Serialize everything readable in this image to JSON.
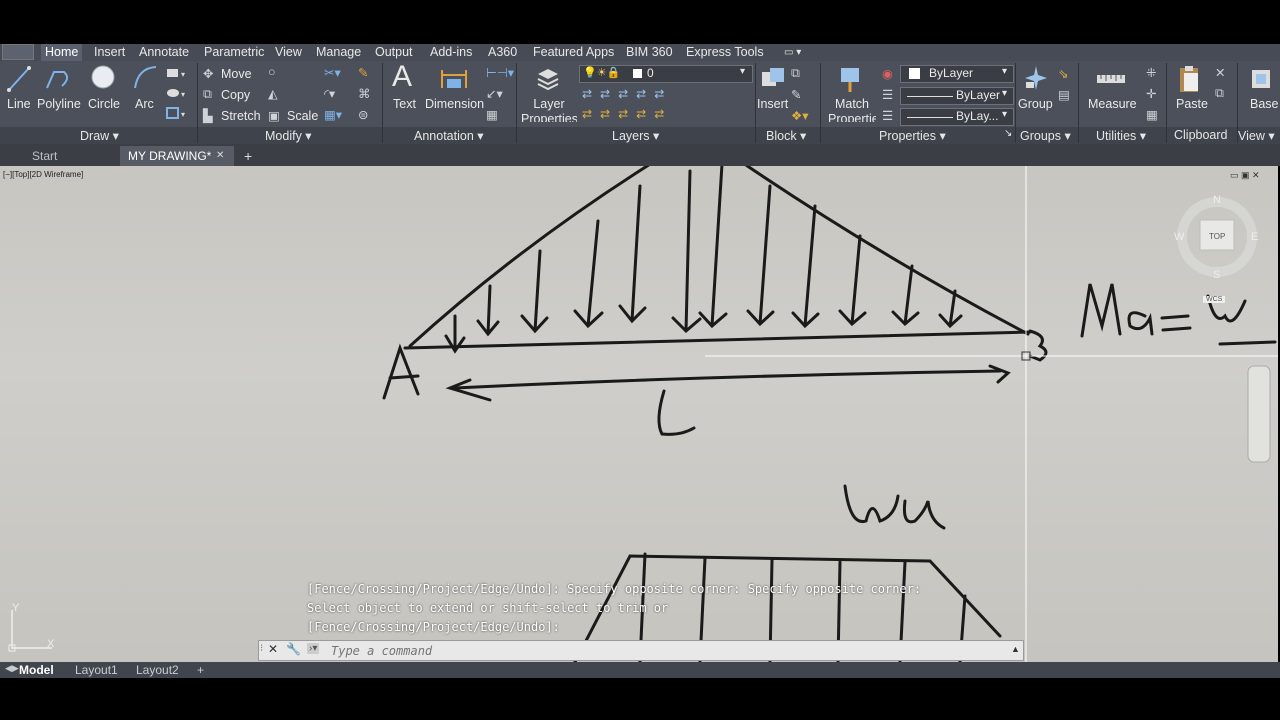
{
  "ribbon": {
    "tabs": [
      "Home",
      "Insert",
      "Annotate",
      "Parametric",
      "View",
      "Manage",
      "Output",
      "Add-ins",
      "A360",
      "Featured Apps",
      "BIM 360",
      "Express Tools"
    ],
    "draw": {
      "line": "Line",
      "polyline": "Polyline",
      "circle": "Circle",
      "arc": "Arc",
      "panel": "Draw"
    },
    "modify": {
      "move": "Move",
      "copy": "Copy",
      "stretch": "Stretch",
      "scale": "Scale",
      "panel": "Modify"
    },
    "annotation": {
      "text": "Text",
      "dimension": "Dimension",
      "panel": "Annotation"
    },
    "layers": {
      "layer_properties": "Layer Properties",
      "current_layer": "0",
      "panel": "Layers"
    },
    "block": {
      "insert": "Insert",
      "panel": "Block"
    },
    "properties": {
      "match": "Match Properties",
      "color": "ByLayer",
      "linetype": "ByLayer",
      "lineweight": "ByLay...",
      "panel": "Properties"
    },
    "groups": {
      "group": "Group",
      "panel": "Groups"
    },
    "utilities": {
      "measure": "Measure",
      "panel": "Utilities"
    },
    "clipboard": {
      "paste": "Paste",
      "panel": "Clipboard"
    },
    "view": {
      "base": "Base",
      "panel": "View"
    }
  },
  "doc_tabs": {
    "start": "Start",
    "current": "MY DRAWING*",
    "close": "✕",
    "add": "+"
  },
  "viewport": {
    "label": "[−][Top][2D Wireframe]"
  },
  "viewcube": {
    "n": "N",
    "s": "S",
    "e": "E",
    "w": "W",
    "face": "TOP",
    "wcs": "WCS"
  },
  "ucs": {
    "x": "X",
    "y": "Y"
  },
  "sketch": {
    "left_support": "A",
    "right_support": "B",
    "span": "L",
    "moment": "Ma =",
    "load": "Wu"
  },
  "command": {
    "history": [
      "[Fence/Crossing/Project/Edge/Undo]: Specify opposite corner: Specify opposite corner:",
      "Select object to extend or shift-select to trim or",
      "[Fence/Crossing/Project/Edge/Undo]:"
    ],
    "placeholder": "Type a command"
  },
  "layout_tabs": {
    "model": "Model",
    "layout1": "Layout1",
    "layout2": "Layout2",
    "add": "+"
  },
  "colors": {
    "ribbon": "#4b505a",
    "canvas": "#c9c8c3",
    "ink": "#1a1a1a"
  }
}
